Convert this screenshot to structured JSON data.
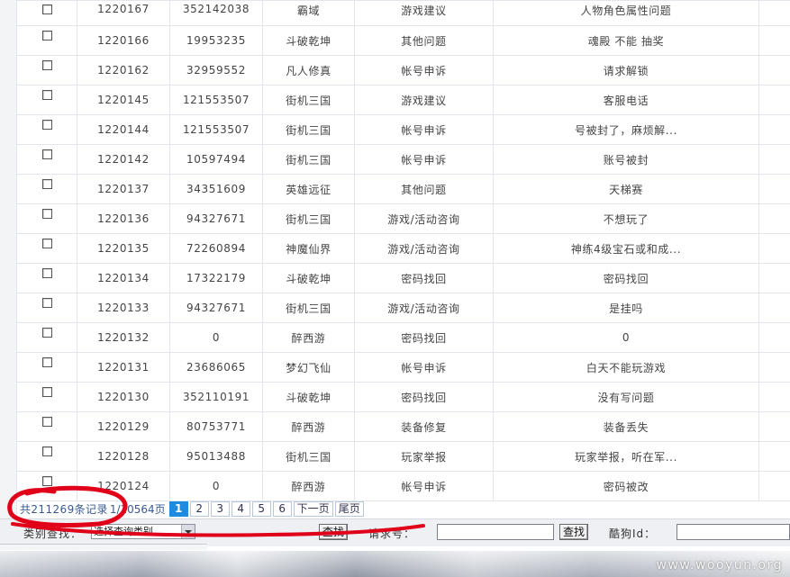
{
  "table": {
    "rows": [
      {
        "id": "1220167",
        "account": "352142038",
        "game": "霸域",
        "category": "游戏建议",
        "subject": "人物角色属性问题"
      },
      {
        "id": "1220166",
        "account": "19953235",
        "game": "斗破乾坤",
        "category": "其他问题",
        "subject": "魂殿 不能 抽奖"
      },
      {
        "id": "1220162",
        "account": "32959552",
        "game": "凡人修真",
        "category": "帐号申诉",
        "subject": "请求解锁"
      },
      {
        "id": "1220145",
        "account": "121553507",
        "game": "街机三国",
        "category": "游戏建议",
        "subject": "客服电话"
      },
      {
        "id": "1220144",
        "account": "121553507",
        "game": "街机三国",
        "category": "帐号申诉",
        "subject": "号被封了，麻烦解..."
      },
      {
        "id": "1220142",
        "account": "10597494",
        "game": "街机三国",
        "category": "帐号申诉",
        "subject": "账号被封"
      },
      {
        "id": "1220137",
        "account": "34351609",
        "game": "英雄远征",
        "category": "其他问题",
        "subject": "天梯赛"
      },
      {
        "id": "1220136",
        "account": "94327671",
        "game": "街机三国",
        "category": "游戏/活动咨询",
        "subject": "不想玩了"
      },
      {
        "id": "1220135",
        "account": "72260894",
        "game": "神魔仙界",
        "category": "游戏/活动咨询",
        "subject": "神练4级宝石或和成..."
      },
      {
        "id": "1220134",
        "account": "17322179",
        "game": "斗破乾坤",
        "category": "密码找回",
        "subject": "密码找回"
      },
      {
        "id": "1220133",
        "account": "94327671",
        "game": "街机三国",
        "category": "游戏/活动咨询",
        "subject": "是挂吗"
      },
      {
        "id": "1220132",
        "account": "0",
        "game": "醉西游",
        "category": "密码找回",
        "subject": "0"
      },
      {
        "id": "1220131",
        "account": "23686065",
        "game": "梦幻飞仙",
        "category": "帐号申诉",
        "subject": "白天不能玩游戏"
      },
      {
        "id": "1220130",
        "account": "352110191",
        "game": "斗破乾坤",
        "category": "密码找回",
        "subject": "没有写问题"
      },
      {
        "id": "1220129",
        "account": "80753771",
        "game": "醉西游",
        "category": "装备修复",
        "subject": "装备丢失"
      },
      {
        "id": "1220128",
        "account": "95013488",
        "game": "街机三国",
        "category": "玩家举报",
        "subject": "玩家举报，听在军..."
      },
      {
        "id": "1220124",
        "account": "0",
        "game": "醉西游",
        "category": "帐号申诉",
        "subject": "密码被改"
      }
    ]
  },
  "pager": {
    "total_records": "共211269条记录",
    "page_info": "1/10564页",
    "pages": [
      "1",
      "2",
      "3",
      "4",
      "5",
      "6"
    ],
    "current_page": "1",
    "next_label": "下一页",
    "last_label": "尾页"
  },
  "search": {
    "category_label": "类别查找：",
    "category_value": "选择查询类别",
    "find_label": "查找",
    "field2_label": "请求号：",
    "field2_value": "",
    "find2_label": "查找",
    "kugou_label": "酷狗Id：",
    "kugou_value": ""
  },
  "watermark": "www.wooyun.org",
  "colors": {
    "accent": "#1f8be0",
    "annotation": "#e0001a",
    "link": "#3a5b8f"
  }
}
